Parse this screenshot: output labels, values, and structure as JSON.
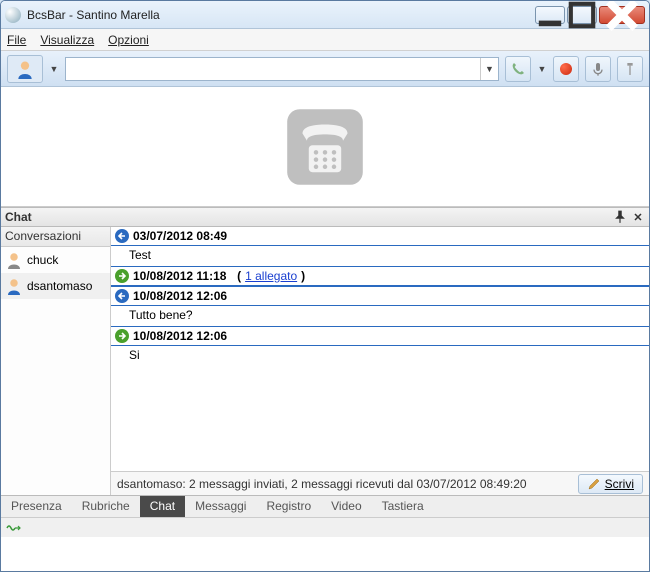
{
  "window": {
    "title": "BcsBar - Santino Marella"
  },
  "menu": {
    "file": "File",
    "visualizza": "Visualizza",
    "opzioni": "Opzioni"
  },
  "toolbar": {
    "search_value": ""
  },
  "chat": {
    "panel_title": "Chat",
    "conversations_label": "Conversazioni",
    "conversations": [
      {
        "name": "chuck"
      },
      {
        "name": "dsantomaso"
      }
    ],
    "messages": [
      {
        "direction": "in",
        "timestamp": "03/07/2012 08:49",
        "attachment": "",
        "text": "Test"
      },
      {
        "direction": "out",
        "timestamp": "10/08/2012 11:18",
        "attachment": "1 allegato",
        "text": ""
      },
      {
        "direction": "in",
        "timestamp": "10/08/2012 12:06",
        "attachment": "",
        "text": "Tutto bene?"
      },
      {
        "direction": "out",
        "timestamp": "10/08/2012 12:06",
        "attachment": "",
        "text": "Si"
      }
    ],
    "status": "dsantomaso: 2 messaggi inviati, 2 messaggi ricevuti dal 03/07/2012 08:49:20",
    "write_button": "Scrivi"
  },
  "bottom_tabs": {
    "presenza": "Presenza",
    "rubriche": "Rubriche",
    "chat": "Chat",
    "messaggi": "Messaggi",
    "registro": "Registro",
    "video": "Video",
    "tastiera": "Tastiera"
  }
}
